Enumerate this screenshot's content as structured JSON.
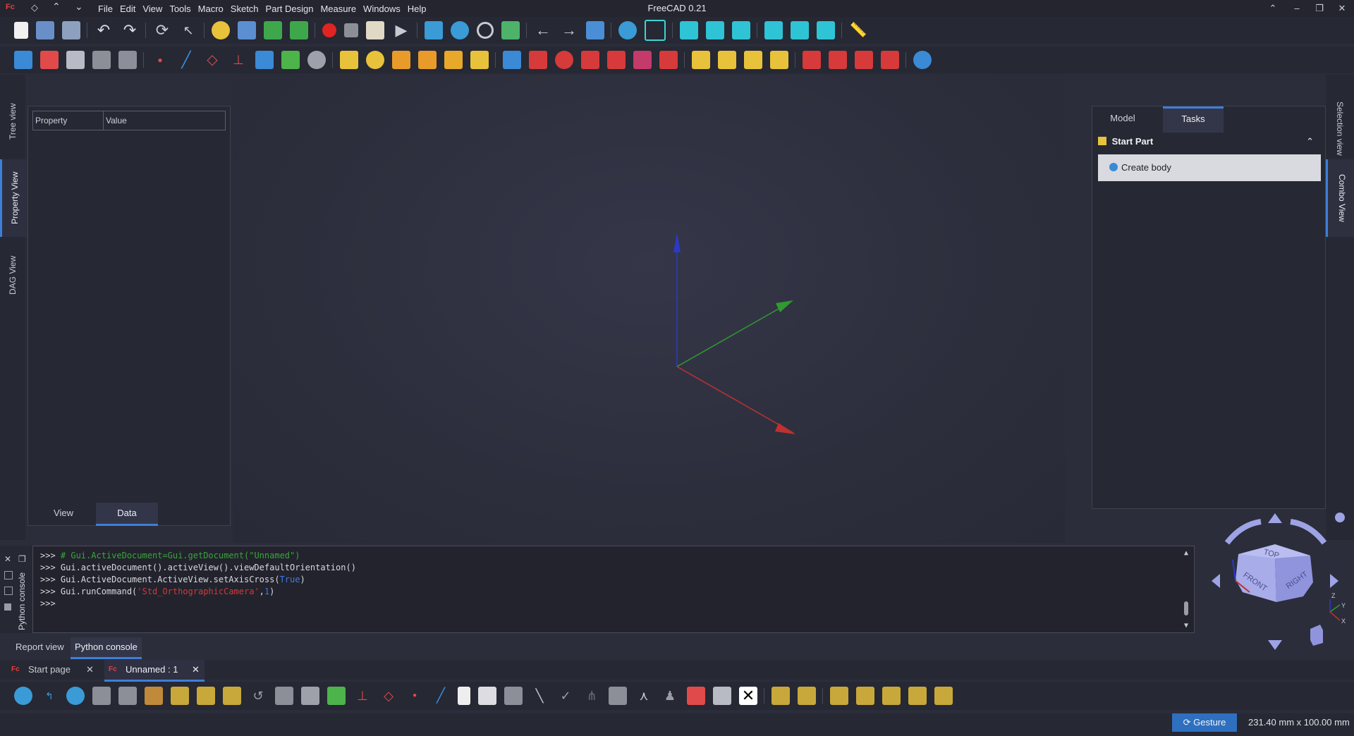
{
  "window": {
    "title": "FreeCAD 0.21"
  },
  "menu": [
    "File",
    "Edit",
    "View",
    "Tools",
    "Macro",
    "Sketch",
    "Part Design",
    "Measure",
    "Windows",
    "Help"
  ],
  "left_tabs": {
    "tree": "Tree view",
    "property": "Property View",
    "dag": "DAG View"
  },
  "right_tabs": {
    "selection": "Selection view",
    "combo": "Combo View"
  },
  "property_panel": {
    "col_property": "Property",
    "col_value": "Value",
    "tab_view": "View",
    "tab_data": "Data"
  },
  "combo": {
    "tab_model": "Model",
    "tab_tasks": "Tasks",
    "task_header": "Start Part",
    "task_item": "Create body"
  },
  "console": {
    "line1_prompt": ">>> ",
    "line1_text": "# Gui.ActiveDocument=Gui.getDocument(\"Unnamed\")",
    "line2": ">>> Gui.activeDocument().activeView().viewDefaultOrientation()",
    "line3_a": ">>> Gui.ActiveDocument.ActiveView.setAxisCross(",
    "line3_b": "True",
    "line3_c": ")",
    "line4_a": ">>> Gui.runCommand(",
    "line4_b": "'Std_OrthographicCamera'",
    "line4_c": ",",
    "line4_d": "1",
    "line4_e": ")",
    "line5": ">>>",
    "strip_label": "Python console"
  },
  "bottom_tabs": {
    "report": "Report view",
    "python": "Python console"
  },
  "doc_tabs": {
    "start": "Start page",
    "unnamed": "Unnamed : 1"
  },
  "navcube": {
    "top": "TOP",
    "front": "FRONT",
    "right": "RIGHT",
    "axis_z": "Z",
    "axis_x": "X",
    "axis_y": "Y"
  },
  "status": {
    "gesture": "Gesture",
    "dimensions": "231.40 mm x 100.00 mm"
  },
  "colors": {
    "accent": "#3d7fd8",
    "axis_x": "#c03030",
    "axis_y": "#2f9a2f",
    "axis_z": "#2a3ac8",
    "record": "#e02424"
  }
}
